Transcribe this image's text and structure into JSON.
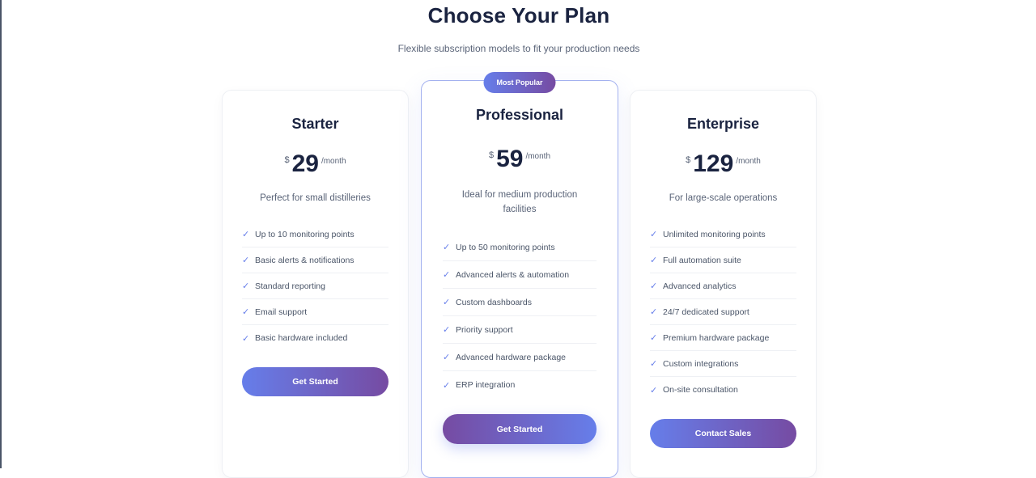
{
  "header": {
    "title": "Choose Your Plan",
    "subtitle": "Flexible subscription models to fit your production needs"
  },
  "plans": [
    {
      "name": "Starter",
      "currency": "$",
      "price": "29",
      "period": "/month",
      "description": "Perfect for small distilleries",
      "features": [
        "Up to 10 monitoring points",
        "Basic alerts & notifications",
        "Standard reporting",
        "Email support",
        "Basic hardware included"
      ],
      "cta_label": "Get Started"
    },
    {
      "name": "Professional",
      "badge": "Most Popular",
      "currency": "$",
      "price": "59",
      "period": "/month",
      "description": "Ideal for medium production facilities",
      "features": [
        "Up to 50 monitoring points",
        "Advanced alerts & automation",
        "Custom dashboards",
        "Priority support",
        "Advanced hardware package",
        "ERP integration"
      ],
      "cta_label": "Get Started"
    },
    {
      "name": "Enterprise",
      "currency": "$",
      "price": "129",
      "period": "/month",
      "description": "For large-scale operations",
      "features": [
        "Unlimited monitoring points",
        "Full automation suite",
        "Advanced analytics",
        "24/7 dedicated support",
        "Premium hardware package",
        "Custom integrations",
        "On-site consultation"
      ],
      "cta_label": "Contact Sales"
    }
  ],
  "icons": {
    "feature_check": "check-icon"
  },
  "colors": {
    "accent_start": "#667eea",
    "accent_end": "#764ba2",
    "heading": "#1a2340",
    "muted": "#5a6478",
    "featured_border": "#a3b1ef"
  }
}
